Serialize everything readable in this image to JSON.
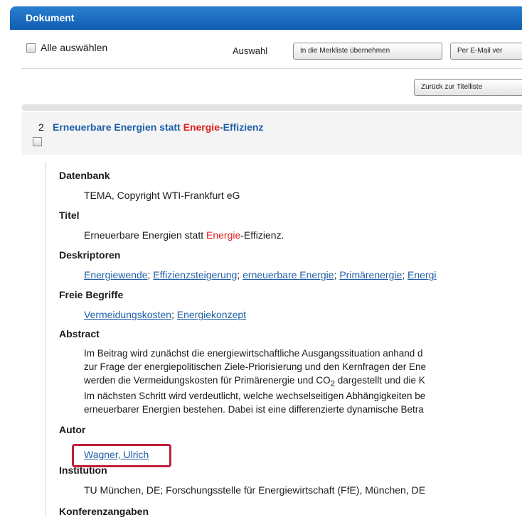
{
  "header": {
    "title": "Dokument"
  },
  "toolbar": {
    "select_all": "Alle auswählen",
    "selection_label": "Auswahl",
    "merkliste_button": "In die Merkliste übernehmen",
    "email_button": "Per E-Mail ver",
    "back_button": "Zurück zur Titelliste"
  },
  "result": {
    "number": "2",
    "title_pre": "Erneuerbare Energien statt ",
    "title_hl": "Energie",
    "title_post": "-Effizienz"
  },
  "details": {
    "datenbank": {
      "label": "Datenbank",
      "value": "TEMA, Copyright WTI-Frankfurt eG"
    },
    "titel": {
      "label": "Titel",
      "pre": "Erneuerbare Energien statt ",
      "hl": "Energie",
      "post": "-Effizienz."
    },
    "deskriptoren": {
      "label": "Deskriptoren",
      "links": [
        "Energiewende",
        "Effizienzsteigerung",
        "erneuerbare Energie",
        "Primärenergie",
        "Energi"
      ],
      "separator": "; "
    },
    "freie_begriffe": {
      "label": "Freie Begriffe",
      "links": [
        "Vermeidungskosten",
        "Energiekonzept"
      ],
      "separator": "; "
    },
    "abstract": {
      "label": "Abstract",
      "line1": "Im Beitrag wird zunächst die energiewirtschaftliche Ausgangssituation anhand d",
      "line2": "zur Frage der energiepolitischen Ziele-Priorisierung und den Kernfragen der Ene",
      "line3_pre": "werden die Vermeidungskosten für Primärenergie und CO",
      "line3_sub": "2",
      "line3_post": " dargestellt und die K",
      "line4": "Im nächsten Schritt wird verdeutlicht, welche wechselseitigen Abhängigkeiten be",
      "line5": "erneuerbarer Energien bestehen. Dabei ist eine differenzierte dynamische Betra"
    },
    "autor": {
      "label": "Autor",
      "value": "Wagner, Ulrich"
    },
    "institution": {
      "label": "Institution",
      "value": "TU München, DE; Forschungsstelle für Energiewirtschaft (FfE), München, DE"
    },
    "konferenz": {
      "label": "Konferenzangaben"
    }
  },
  "colors": {
    "header": "#1565c0",
    "link": "#1f5fa8",
    "highlight": "#e02020",
    "annotation_box": "#c0203a"
  }
}
